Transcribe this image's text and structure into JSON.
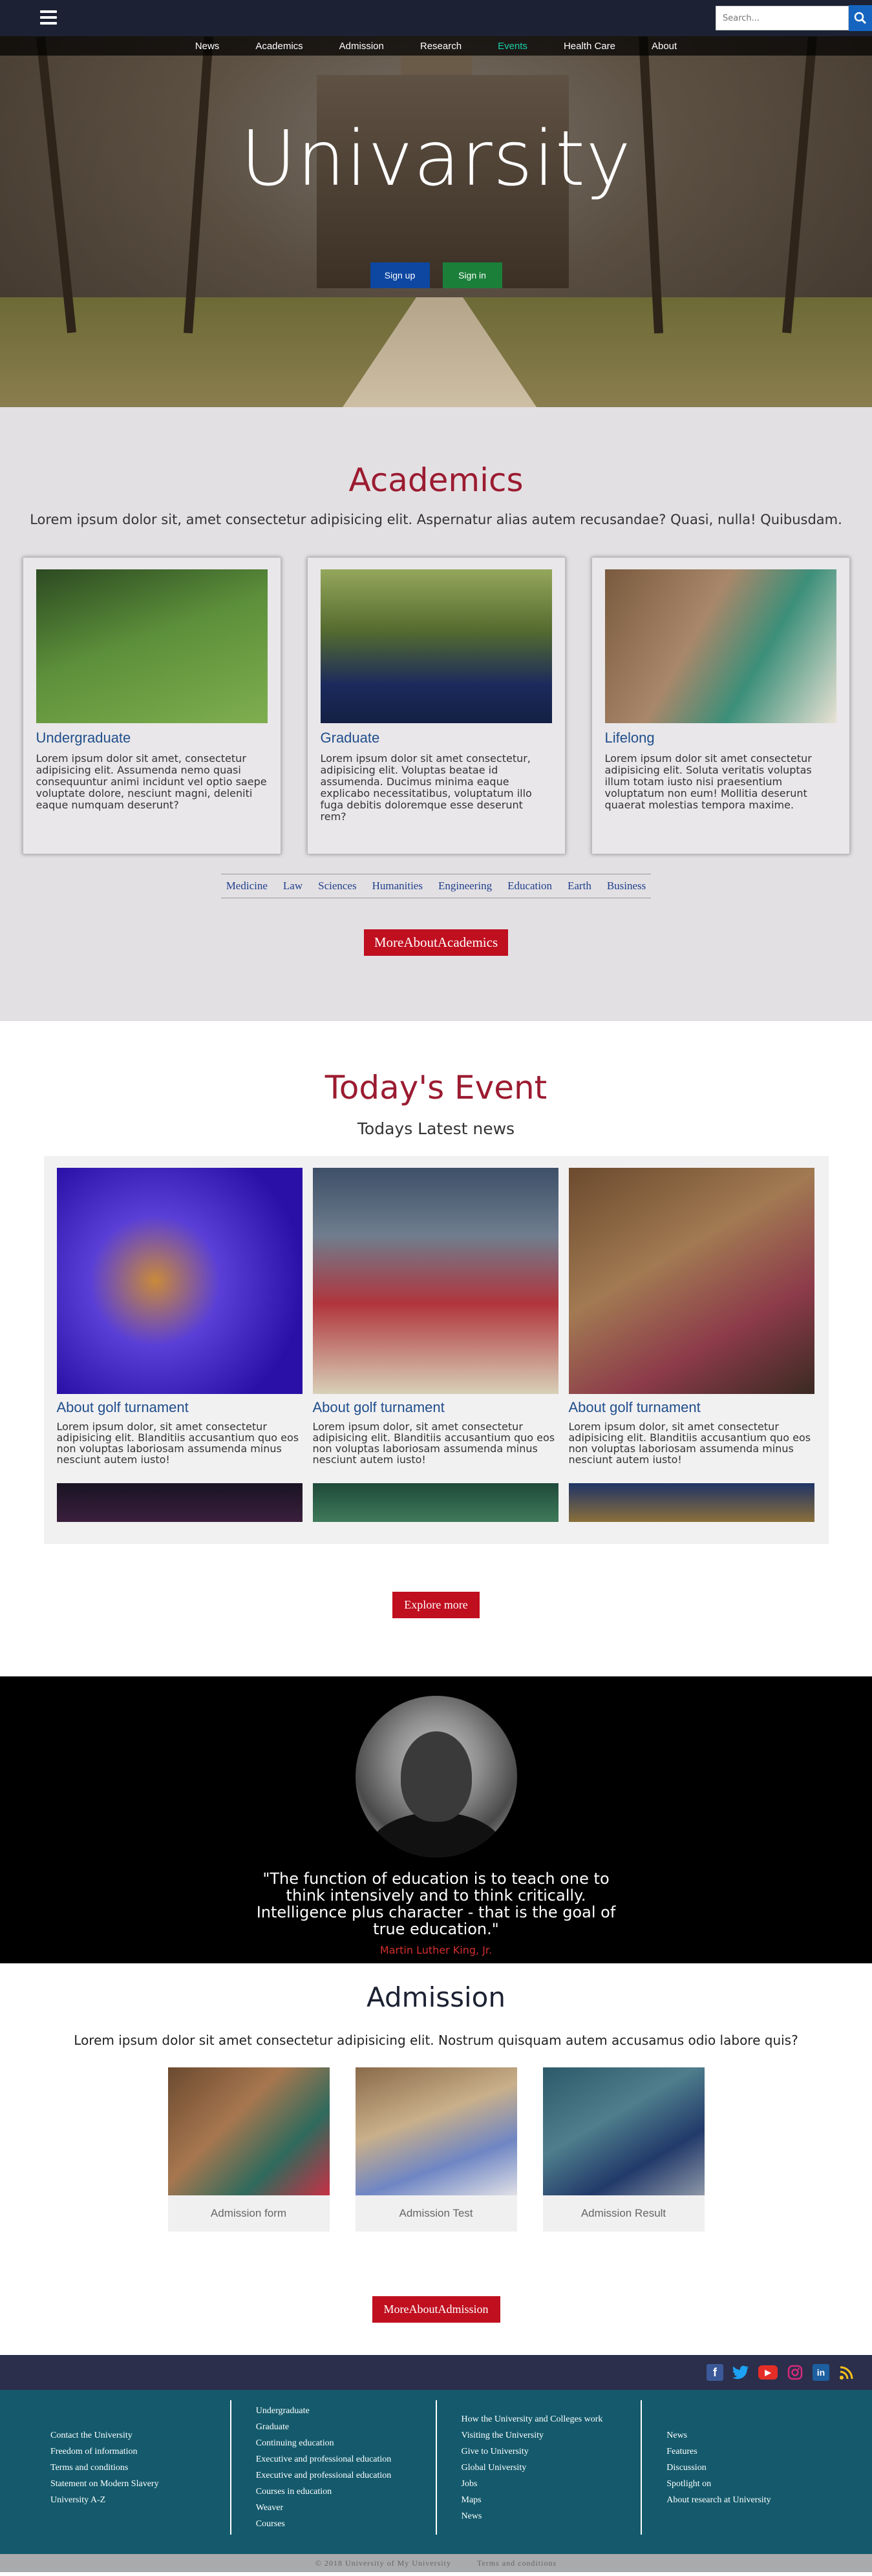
{
  "header": {
    "search_placeholder": "Search..."
  },
  "nav": [
    "News",
    "Academics",
    "Admission",
    "Research",
    "Events",
    "Health Care",
    "About"
  ],
  "nav_active": "Events",
  "hero": {
    "title": "Univarsity",
    "signup_label": "Sign up",
    "signin_label": "Sign in"
  },
  "academics": {
    "title": "Academics",
    "lead": "Lorem ipsum dolor sit, amet consectetur adipisicing elit. Aspernatur alias autem recusandae? Quasi, nulla! Quibusdam.",
    "cards": [
      {
        "title": "Undergraduate",
        "text": "Lorem ipsum dolor sit amet, consectetur adipisicing elit. Assumenda nemo quasi consequuntur animi incidunt vel optio saepe voluptate dolore, nesciunt magni, deleniti eaque numquam deserunt?"
      },
      {
        "title": "Graduate",
        "text": "Lorem ipsum dolor sit amet consectetur, adipisicing elit. Voluptas beatae id assumenda. Ducimus minima eaque explicabo necessitatibus, voluptatum illo fuga debitis doloremque esse deserunt rem?"
      },
      {
        "title": "Lifelong",
        "text": "Lorem ipsum dolor sit amet consectetur adipisicing elit. Soluta veritatis voluptas illum totam iusto nisi praesentium voluptatum non eum! Mollitia deserunt quaerat molestias tempora maxime."
      }
    ],
    "fields": [
      "Medicine",
      "Law",
      "Sciences",
      "Humanities",
      "Engineering",
      "Education",
      "Earth",
      "Business"
    ],
    "more_label": "MoreAboutAcademics"
  },
  "events": {
    "title": "Today's Event",
    "subtitle": "Todays Latest news",
    "items": [
      {
        "title": "About golf turnament",
        "text": "Lorem ipsum dolor, sit amet consectetur adipisicing elit. Blanditiis accusantium quo eos non voluptas laboriosam assumenda minus nesciunt autem iusto!"
      },
      {
        "title": "About golf turnament",
        "text": "Lorem ipsum dolor, sit amet consectetur adipisicing elit. Blanditiis accusantium quo eos non voluptas laboriosam assumenda minus nesciunt autem iusto!"
      },
      {
        "title": "About golf turnament",
        "text": "Lorem ipsum dolor, sit amet consectetur adipisicing elit. Blanditiis accusantium quo eos non voluptas laboriosam assumenda minus nesciunt autem iusto!"
      }
    ],
    "explore_label": "Explore more"
  },
  "quote": {
    "text": "\"The function of education is to teach one to think intensively and to think critically. Intelligence plus character - that is the goal of true education.\"",
    "author": "Martin Luther King, Jr."
  },
  "admission": {
    "title": "Admission",
    "lead": "Lorem ipsum dolor sit amet consectetur adipisicing elit. Nostrum quisquam autem accusamus odio labore quis?",
    "cards": [
      "Admission form",
      "Admission Test",
      "Admission Result"
    ],
    "more_label": "MoreAboutAdmission"
  },
  "social": [
    "facebook-icon",
    "twitter-icon",
    "youtube-icon",
    "instagram-icon",
    "linkedin-icon",
    "rss-icon"
  ],
  "footer": {
    "col1": [
      "Contact the University",
      "Freedom of information",
      "Terms and conditions",
      "Statement on Modern Slavery",
      "University A-Z"
    ],
    "col2": [
      "Undergraduate",
      "Graduate",
      "Continuing education",
      "Executive and professional education",
      "Executive and professional education",
      "Courses in education",
      "Weaver",
      "Courses"
    ],
    "col3": [
      "How the University and Colleges work",
      "Visiting the University",
      "Give to University",
      "Global University",
      "Jobs",
      "Maps",
      "News"
    ],
    "col4": [
      "News",
      "Features",
      "Discussion",
      "Spotlight on",
      "About research at University"
    ],
    "copyright": "© 2018 University of My University",
    "terms": "Terms and conditions"
  },
  "colors": {
    "topbar": "#1c2233",
    "accent_red": "#c00f1f",
    "title_red": "#9b1b30",
    "footer": "#145a6c",
    "social_bar": "#2b2f4b",
    "active_nav": "#19d0a8"
  }
}
